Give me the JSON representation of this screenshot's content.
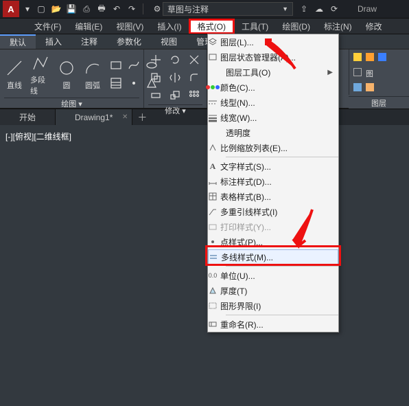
{
  "app": {
    "logo": "A",
    "workspace_label": "草图与注释",
    "title_suffix": "Draw"
  },
  "menubar": {
    "items": [
      {
        "label": "文件(F)"
      },
      {
        "label": "编辑(E)"
      },
      {
        "label": "视图(V)"
      },
      {
        "label": "插入(I)"
      },
      {
        "label": "格式(O)"
      },
      {
        "label": "工具(T)"
      },
      {
        "label": "绘图(D)"
      },
      {
        "label": "标注(N)"
      },
      {
        "label": "修改"
      }
    ],
    "active_index": 4
  },
  "ribbon_tabs": {
    "items": [
      {
        "label": "默认"
      },
      {
        "label": "插入"
      },
      {
        "label": "注释"
      },
      {
        "label": "参数化"
      },
      {
        "label": "视图"
      },
      {
        "label": "管理"
      }
    ],
    "active_index": 0
  },
  "ribbon": {
    "panel_draw": {
      "label": "绘图",
      "tools": [
        {
          "label": "直线"
        },
        {
          "label": "多段线"
        },
        {
          "label": "圆"
        },
        {
          "label": "圆弧"
        }
      ]
    },
    "panel_modify": {
      "label": "修改"
    },
    "panel_layer": {
      "label": "图层"
    }
  },
  "doc_tabs": {
    "items": [
      {
        "label": "开始"
      },
      {
        "label": "Drawing1*"
      }
    ],
    "active_index": 1
  },
  "viewport": {
    "label": "[-][俯视][二维线框]"
  },
  "format_menu": {
    "groups": [
      [
        {
          "label": "图层(L)..."
        },
        {
          "label": "图层状态管理器(A)..."
        },
        {
          "label": "图层工具(O)",
          "submenu": true
        },
        {
          "label": "颜色(C)..."
        },
        {
          "label": "线型(N)..."
        },
        {
          "label": "线宽(W)..."
        },
        {
          "label": "透明度"
        },
        {
          "label": "比例缩放列表(E)..."
        }
      ],
      [
        {
          "label": "文字样式(S)..."
        },
        {
          "label": "标注样式(D)..."
        },
        {
          "label": "表格样式(B)..."
        },
        {
          "label": "多重引线样式(I)"
        },
        {
          "label": "打印样式(Y)..."
        },
        {
          "label": "点样式(P)..."
        },
        {
          "label": "多线样式(M)..."
        }
      ],
      [
        {
          "label": "单位(U)..."
        },
        {
          "label": "厚度(T)"
        },
        {
          "label": "图形界限(I)"
        }
      ],
      [
        {
          "label": "重命名(R)..."
        }
      ]
    ]
  },
  "colors": {
    "accent": "#e11"
  }
}
